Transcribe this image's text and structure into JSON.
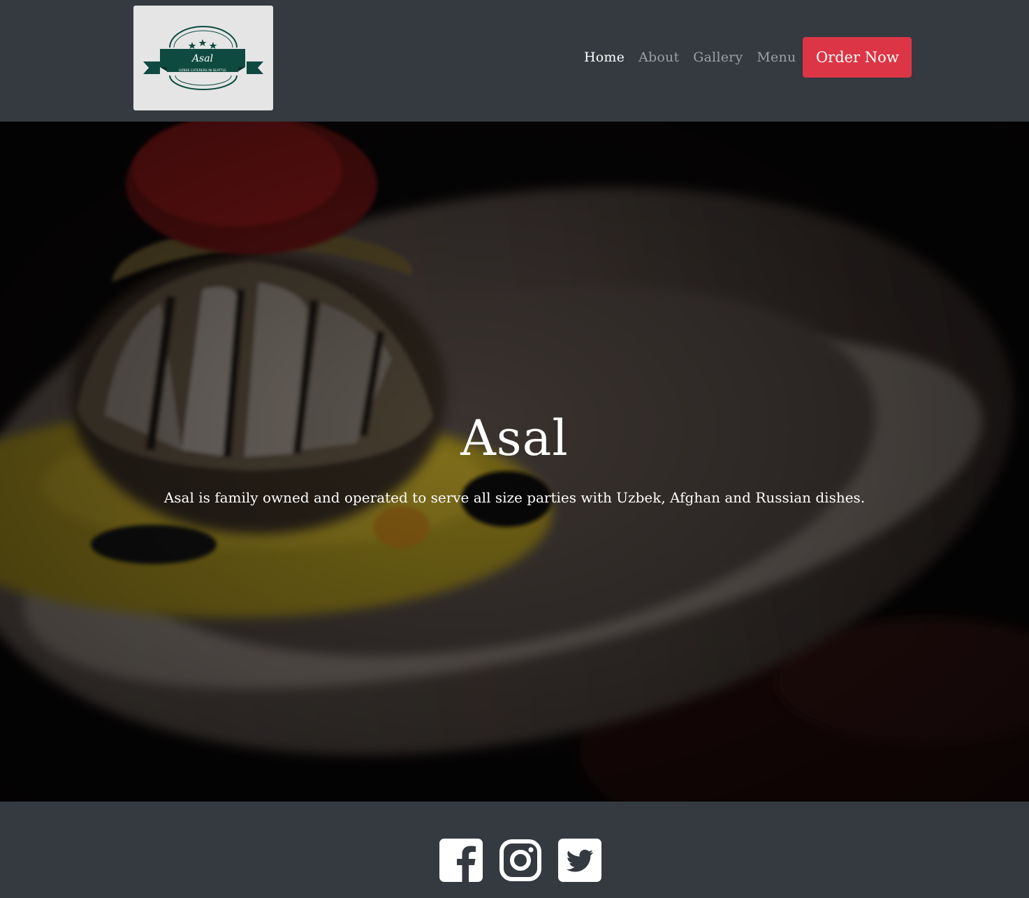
{
  "brand": {
    "logo_name": "Asal",
    "logo_tagline": "UZBEK CATERERS IN SEATTLE",
    "colors": {
      "logo_ribbon": "#0e4a40",
      "logo_bg": "#e5e5e5"
    }
  },
  "nav": {
    "items": [
      {
        "label": "Home",
        "active": true
      },
      {
        "label": "About",
        "active": false
      },
      {
        "label": "Gallery",
        "active": false
      },
      {
        "label": "Menu",
        "active": false
      }
    ],
    "cta_label": "Order Now",
    "cta_color": "#dc3545"
  },
  "hero": {
    "title": "Asal",
    "subtitle": "Asal is family owned and operated to serve all size parties with Uzbek, Afghan and Russian dishes."
  },
  "footer": {
    "social": [
      {
        "icon": "facebook-icon"
      },
      {
        "icon": "instagram-icon"
      },
      {
        "icon": "twitter-icon"
      }
    ]
  },
  "theme": {
    "dark_bg": "#343a40",
    "text_light": "#ffffff",
    "text_muted": "#9aa0a6"
  }
}
